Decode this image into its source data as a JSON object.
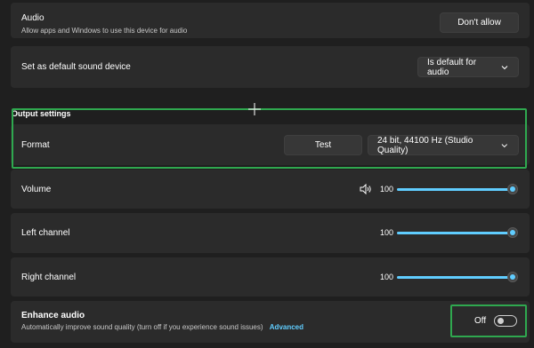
{
  "audio": {
    "title": "Audio",
    "description": "Allow apps and Windows to use this device for audio",
    "button_label": "Don't allow"
  },
  "default_device": {
    "title": "Set as default sound device",
    "dropdown_value": "Is default for audio"
  },
  "output_settings": {
    "heading": "Output settings",
    "format_label": "Format",
    "test_label": "Test",
    "format_value": "24 bit, 44100 Hz (Studio Quality)"
  },
  "volume": {
    "label": "Volume",
    "value": "100",
    "level": 1.0
  },
  "left_channel": {
    "label": "Left channel",
    "value": "100",
    "level": 1.0
  },
  "right_channel": {
    "label": "Right channel",
    "value": "100",
    "level": 1.0
  },
  "enhance": {
    "title": "Enhance audio",
    "description": "Automatically improve sound quality (turn off if you experience sound issues)",
    "link": "Advanced",
    "toggle_label": "Off"
  },
  "colors": {
    "accent": "#60cdff",
    "highlight": "#2fa84f"
  },
  "icons": {
    "dropdown": "chevron-down-icon",
    "speaker": "speaker-icon"
  }
}
